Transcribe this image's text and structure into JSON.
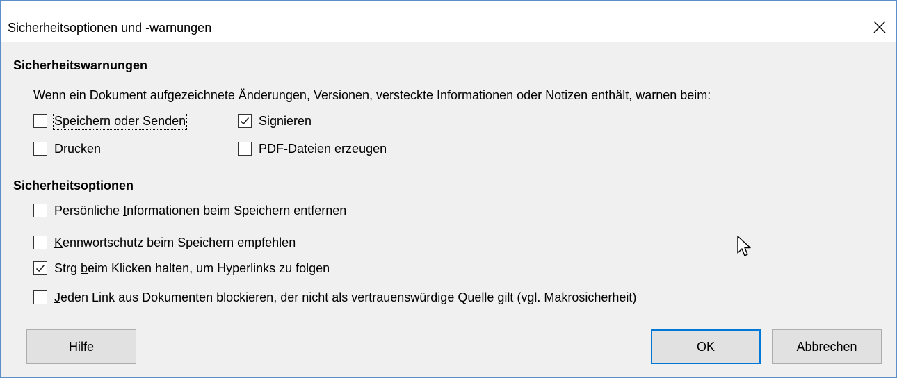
{
  "dialog": {
    "title": "Sicherheitsoptionen und -warnungen"
  },
  "warnings": {
    "heading": "Sicherheitswarnungen",
    "description": "Wenn ein Dokument aufgezeichnete Änderungen, Versionen, versteckte Informationen oder Notizen enthält, warnen beim:",
    "options": [
      {
        "pre": "",
        "u": "S",
        "post": "peichern oder Senden",
        "checked": false
      },
      {
        "pre": "Si",
        "u": "g",
        "post": "nieren",
        "checked": true
      },
      {
        "pre": "",
        "u": "D",
        "post": "rucken",
        "checked": false
      },
      {
        "pre": "",
        "u": "P",
        "post": "DF-Dateien erzeugen",
        "checked": false
      }
    ]
  },
  "security": {
    "heading": "Sicherheitsoptionen",
    "options": [
      {
        "pre": "Persönliche ",
        "u": "I",
        "post": "nformationen beim Speichern entfernen",
        "checked": false
      },
      {
        "pre": "",
        "u": "K",
        "post": "ennwortschutz beim Speichern empfehlen",
        "checked": false
      },
      {
        "pre": "Strg ",
        "u": "b",
        "post": "eim Klicken halten, um Hyperlinks zu folgen",
        "checked": true
      },
      {
        "pre": "",
        "u": "J",
        "post": "eden Link aus Dokumenten blockieren, der nicht als vertrauenswürdige Quelle gilt (vgl. Makrosicherheit)",
        "checked": false
      }
    ]
  },
  "buttons": {
    "help": {
      "u": "H",
      "post": "ilfe"
    },
    "ok": "OK",
    "cancel": "Abbrechen"
  },
  "colors": {
    "accent": "#0078d7",
    "dialog_border": "#5b8fc9"
  },
  "icons": {
    "close": "close-icon",
    "check": "checkmark-icon",
    "cursor": "mouse-pointer-icon"
  }
}
